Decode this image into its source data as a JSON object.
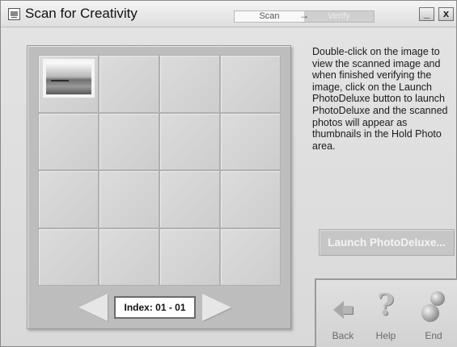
{
  "window": {
    "title": "Scan for Creativity",
    "steps": [
      "Scan",
      "Verify"
    ],
    "minimize_label": "_",
    "close_label": "x"
  },
  "index": {
    "label": "Index: 01 - 01"
  },
  "instructions": "Double-click on the image to view the scanned image and when finished verifying the image, click on the Launch PhotoDeluxe button to launch PhotoDeluxe and the scanned photos will appear as thumbnails in the Hold Photo area.",
  "launch_button": "Launch PhotoDeluxe...",
  "nav": {
    "back": "Back",
    "help": "Help",
    "end": "End"
  },
  "colors": {
    "background": "#d9d9d9",
    "panel": "#bdbdbd",
    "cell": "#d4d4d4"
  },
  "icons": [
    "window-app-icon",
    "arrow-right-icon",
    "back-arrow-icon",
    "help-question-icon",
    "end-balls-icon"
  ]
}
